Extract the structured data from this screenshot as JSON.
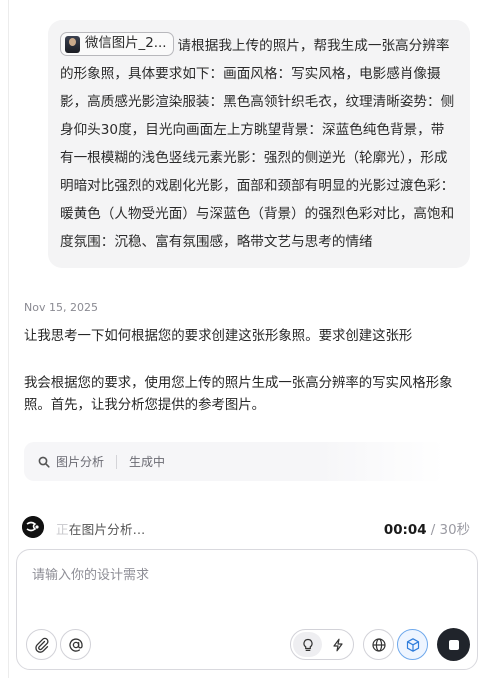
{
  "conversation": {
    "user_message": {
      "attachment_name": "微信图片_2...",
      "text": "请根据我上传的照片，帮我生成一张高分辨率的形象照，具体要求如下：画面风格：写实风格，电影感肖像摄影，高质感光影渲染服装：黑色高领针织毛衣，纹理清晰姿势：侧身仰头30度，目光向画面左上方眺望背景：深蓝色纯色背景，带有一根模糊的浅色竖线元素光影：强烈的侧逆光（轮廓光），形成明暗对比强烈的戏剧化光影，面部和颈部有明显的光影过渡色彩：暖黄色（人物受光面）与深蓝色（背景）的强烈色彩对比，高饱和度氛围：沉稳、富有氛围感，略带文艺与思考的情绪"
    },
    "date": "Nov 15, 2025",
    "assistant": {
      "paragraph_1": "让我思考一下如何根据您的要求创建这张形象照。要求创建这张形",
      "paragraph_2": "我会根据您的要求，使用您上传的照片生成一张高分辨率的写实风格形象照。首先，让我分析您提供的参考图片。"
    },
    "tool_steps": {
      "step_1": "图片分析",
      "step_2": "生成中"
    },
    "status": {
      "faded_char": "正",
      "text": "在图片分析...",
      "elapsed": "00:04",
      "total": " / 30秒"
    }
  },
  "composer": {
    "placeholder": "请输入你的设计需求"
  },
  "icons": {
    "attachment": "paperclip-icon",
    "mention": "at-sign-icon",
    "idea_mode": "lightbulb-icon",
    "fast_mode": "lightning-icon",
    "web": "globe-icon",
    "3d": "cube-icon",
    "stop": "stop-icon",
    "search": "search-icon"
  },
  "colors": {
    "accent": "#6ea8ec",
    "stop_button": "#20242b",
    "bubble": "#f4f4f5"
  }
}
